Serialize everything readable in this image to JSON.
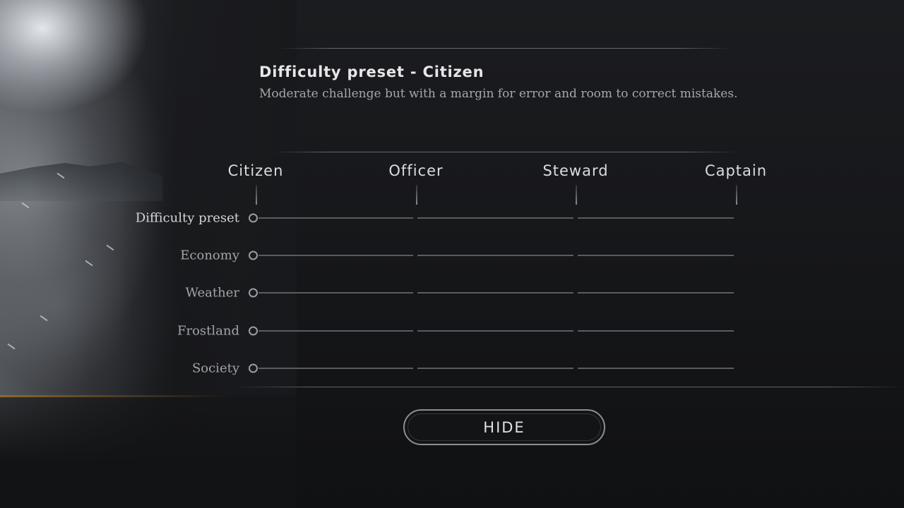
{
  "preset": {
    "title": "Difficulty preset - Citizen",
    "description": "Moderate challenge but with a margin for error and room to correct mistakes."
  },
  "columns": [
    {
      "label": "Citizen"
    },
    {
      "label": "Officer"
    },
    {
      "label": "Steward"
    },
    {
      "label": "Captain"
    }
  ],
  "rows": [
    {
      "label": "Difficulty preset",
      "level": "Citizen"
    },
    {
      "label": "Economy",
      "level": "Citizen"
    },
    {
      "label": "Weather",
      "level": "Citizen"
    },
    {
      "label": "Frostland",
      "level": "Citizen"
    },
    {
      "label": "Society",
      "level": "Citizen"
    }
  ],
  "hide_button": {
    "label": "HIDE"
  },
  "colors": {
    "background": "#17181b",
    "text_primary": "#e6e6e8",
    "text_secondary": "#a6a7aa",
    "track": "#5b5c60",
    "accent_line": "#a87828"
  }
}
